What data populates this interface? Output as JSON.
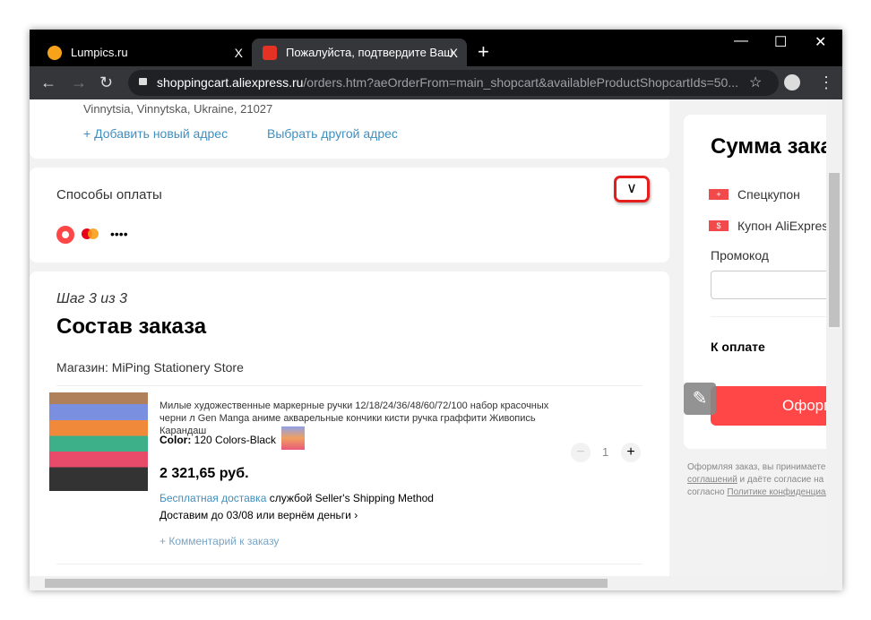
{
  "browser": {
    "tabs": [
      {
        "title": "Lumpics.ru",
        "close": "X"
      },
      {
        "title": "Пожалуйста, подтвердите Ваш з",
        "close": "X"
      }
    ],
    "new_tab": "+",
    "url_host": "shoppingcart.aliexpress.ru",
    "url_path": "/orders.htm?aeOrderFrom=main_shopcart&availableProductShopcartIds=50..."
  },
  "address": {
    "line": "Vinnytsia, Vinnytska, Ukraine, 21027",
    "add": "+ Добавить новый адрес",
    "choose": "Выбрать другой адрес"
  },
  "payment": {
    "title": "Способы оплаты",
    "card_mask": "••••"
  },
  "order": {
    "step": "Шаг 3 из 3",
    "title": "Состав заказа",
    "store": "Магазин: MiPing Stationery Store",
    "item": {
      "name": "Милые художественные маркерные ручки 12/18/24/36/48/60/72/100 набор красочных черни л Gen Manga аниме акварельные кончики кисти ручка граффити Живопись Карандаш",
      "color_label": "Color:",
      "color_value": "120 Colors-Black",
      "price": "2 321,65 руб.",
      "shipping_free": "Бесплатная доставка",
      "shipping_method": "службой Seller's Shipping Method",
      "guarantee": "Доставим до 03/08 или вернём деньги",
      "quantity": "1",
      "comment": "+ Комментарий к заказу"
    }
  },
  "summary": {
    "title": "Сумма заказа",
    "coupon1": "Спецкупон",
    "coupon2": "Купон AliExpress",
    "promo_label": "Промокод",
    "promo_value": "",
    "total_label": "К оплате",
    "checkout": "Оформить заказ",
    "terms1": "Оформляя заказ, вы принимаете",
    "terms2a": "соглашений",
    "terms2b": " и даёте согласие на",
    "terms3a": "согласно ",
    "terms3b": "Политике конфиденциальности"
  },
  "colors": {
    "accent": "#ff4747",
    "link": "#3e8fc0"
  }
}
